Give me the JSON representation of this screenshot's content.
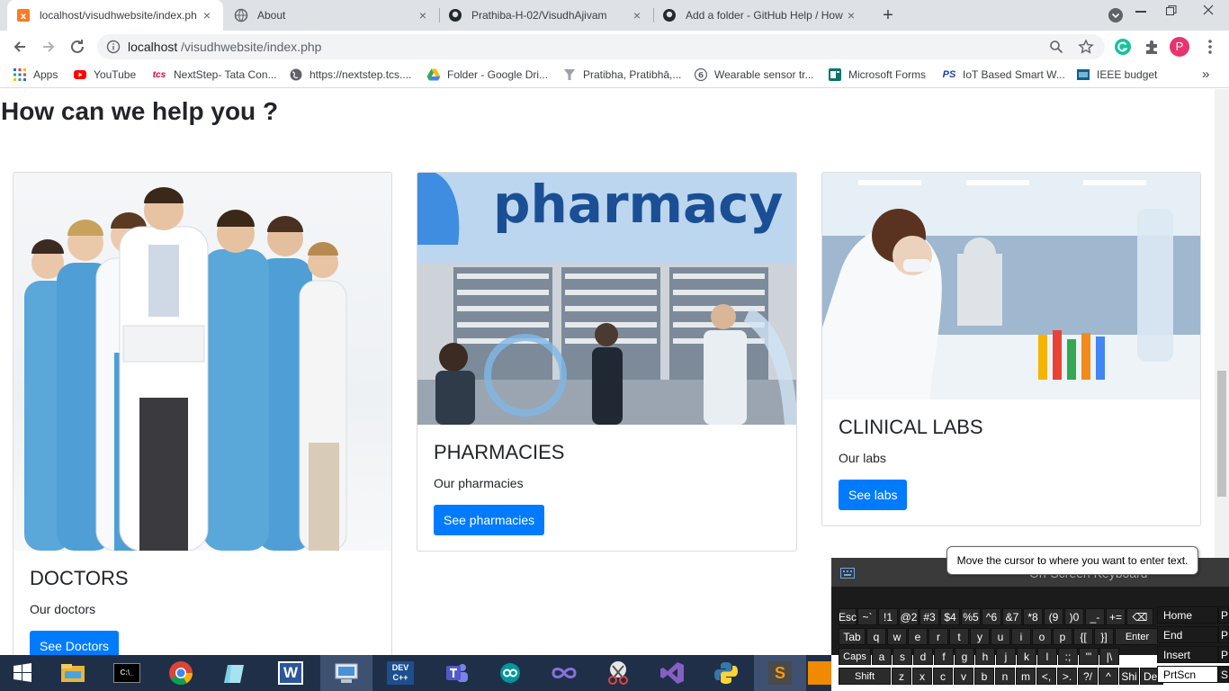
{
  "browser": {
    "tabs": [
      {
        "title": "localhost/visudhwebsite/index.ph",
        "active": true
      },
      {
        "title": "About",
        "active": false
      },
      {
        "title": "Prathiba-H-02/VisudhAjivam",
        "active": false
      },
      {
        "title": "Add a folder - GitHub Help / How",
        "active": false
      }
    ],
    "new_tab": "+",
    "close": "×",
    "url": "localhost/visudhwebsite/index.php",
    "url_host": "localhost",
    "url_path": "/visudhwebsite/index.php",
    "profile_initial": "P",
    "bookmarks": [
      "Apps",
      "YouTube",
      "NextStep- Tata Con...",
      "https://nextstep.tcs....",
      "Folder - Google Dri...",
      "Pratibha, Pratibhā,...",
      "Wearable sensor tr...",
      "Microsoft Forms",
      "IoT Based Smart W...",
      "IEEE budget"
    ],
    "bookmark_more": "»"
  },
  "page": {
    "heading": "How can we help you ?",
    "cards": [
      {
        "title": "DOCTORS",
        "text": "Our doctors",
        "button": "See Doctors"
      },
      {
        "title": "PHARMACIES",
        "text": "Our pharmacies",
        "button": "See pharmacies",
        "image_text": "pharmacy"
      },
      {
        "title": "CLINICAL LABS",
        "text": "Our labs",
        "button": "See labs"
      }
    ]
  },
  "osk": {
    "title": "On-Screen Keyboard",
    "tooltip": "Move the cursor to where you want to enter text.",
    "rows": [
      [
        "Esc",
        "~`",
        "!1",
        "@2",
        "#3",
        "$4",
        "%5",
        "^6",
        "&7",
        "*8",
        "(9",
        ")0",
        "_-",
        "+=",
        "⌫"
      ],
      [
        "Tab",
        "q",
        "w",
        "e",
        "r",
        "t",
        "y",
        "u",
        "i",
        "o",
        "p",
        "{[",
        "}]",
        "Enter"
      ],
      [
        "Caps",
        "a",
        "s",
        "d",
        "f",
        "g",
        "h",
        "j",
        "k",
        "l",
        ":;",
        "\"'",
        "|\\"
      ],
      [
        "Shift",
        "z",
        "x",
        "c",
        "v",
        "b",
        "n",
        "m",
        "<,",
        ">.",
        "?/",
        "^",
        "Shi",
        "Del"
      ]
    ],
    "side_keys": [
      "Home",
      "End",
      "Insert",
      "PrtScn"
    ],
    "side_keys2": [
      "P",
      "P",
      "P",
      "S"
    ]
  },
  "taskbar": {
    "items": [
      "start",
      "explorer",
      "cmd",
      "chrome",
      "notepad",
      "word",
      "system",
      "devc",
      "teams",
      "arduino",
      "infinity",
      "snip",
      "visualstudio",
      "python",
      "sublime",
      "other"
    ],
    "labels": {
      "cmd": "C:\\_",
      "devc": "DEV C++",
      "word": "W",
      "sublime": "S"
    }
  }
}
